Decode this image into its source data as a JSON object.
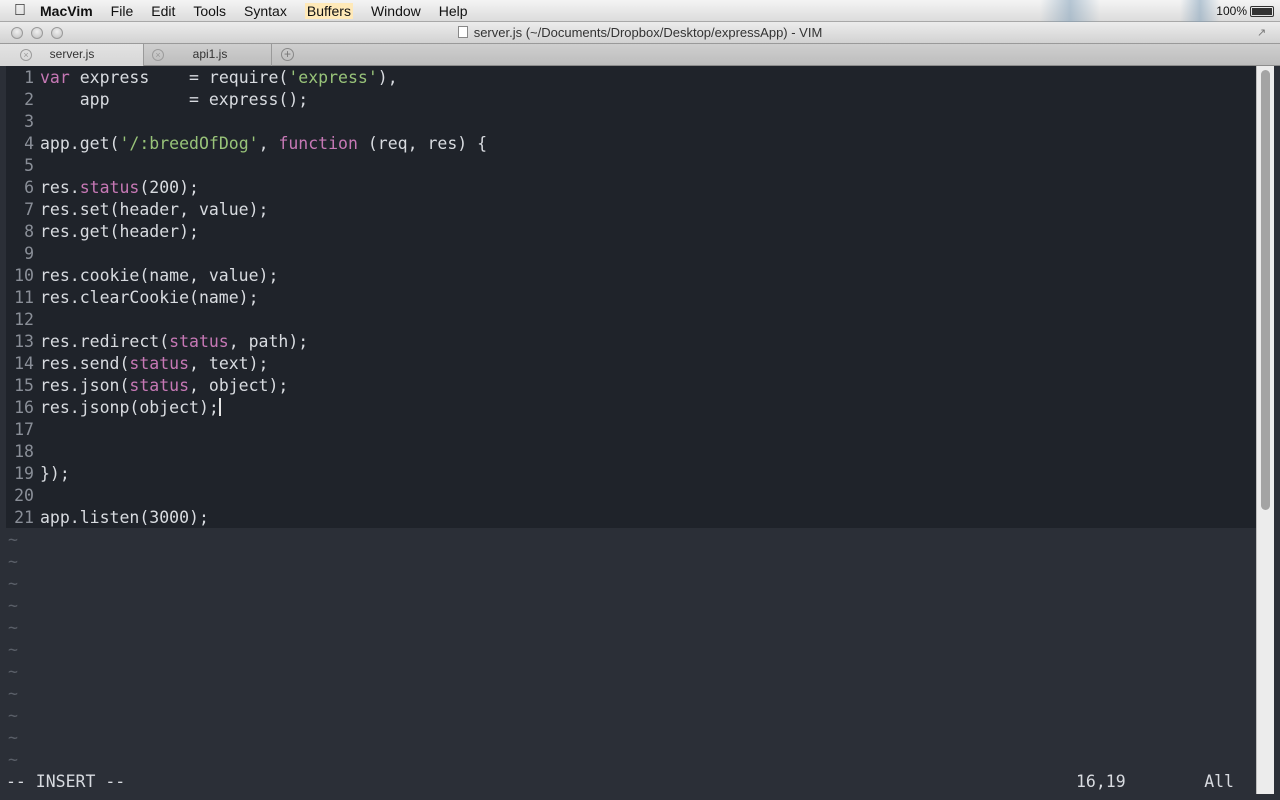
{
  "menubar": {
    "app_name": "MacVim",
    "items": [
      "File",
      "Edit",
      "Tools",
      "Syntax",
      "Buffers",
      "Window",
      "Help"
    ],
    "battery": "100%"
  },
  "window": {
    "title": "server.js (~/Documents/Dropbox/Desktop/expressApp) - VIM"
  },
  "tabs": [
    {
      "label": "server.js",
      "active": true
    },
    {
      "label": "api1.js",
      "active": false
    }
  ],
  "editor": {
    "lines": [
      [
        {
          "t": "var",
          "c": "kw"
        },
        {
          "t": " express    = require("
        },
        {
          "t": "'express'",
          "c": "str"
        },
        {
          "t": "),"
        }
      ],
      [
        {
          "t": "    app        = express();"
        }
      ],
      [],
      [
        {
          "t": "app.get("
        },
        {
          "t": "'/:breedOfDog'",
          "c": "str"
        },
        {
          "t": ", "
        },
        {
          "t": "function",
          "c": "kw"
        },
        {
          "t": " (req, res) {"
        }
      ],
      [],
      [
        {
          "t": "res."
        },
        {
          "t": "status",
          "c": "kw"
        },
        {
          "t": "(200);"
        }
      ],
      [
        {
          "t": "res.set(header, value);"
        }
      ],
      [
        {
          "t": "res.get(header);"
        }
      ],
      [],
      [
        {
          "t": "res.cookie(name, value);"
        }
      ],
      [
        {
          "t": "res.clearCookie(name);"
        }
      ],
      [],
      [
        {
          "t": "res.redirect("
        },
        {
          "t": "status",
          "c": "kw"
        },
        {
          "t": ", path);"
        }
      ],
      [
        {
          "t": "res.send("
        },
        {
          "t": "status",
          "c": "kw"
        },
        {
          "t": ", text);"
        }
      ],
      [
        {
          "t": "res.json("
        },
        {
          "t": "status",
          "c": "kw"
        },
        {
          "t": ", object);"
        }
      ],
      [
        {
          "t": "res.jsonp(object);"
        }
      ],
      [],
      [],
      [
        {
          "t": "});"
        }
      ],
      [],
      [
        {
          "t": "app.listen(3000);"
        }
      ]
    ],
    "cursor_line": 16,
    "tilde_count": 11,
    "tilde": "~"
  },
  "statusline": {
    "mode": "-- INSERT --",
    "position": "16,19",
    "scroll": "All"
  }
}
